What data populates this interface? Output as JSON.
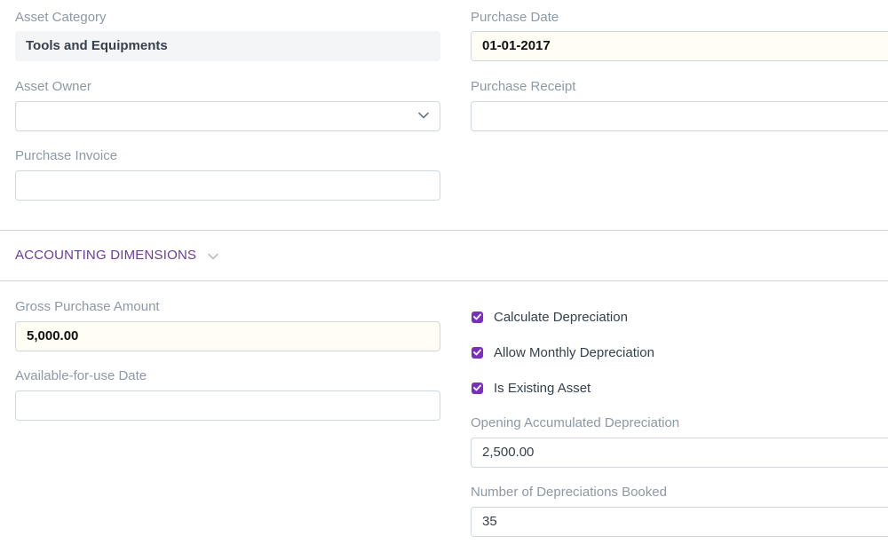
{
  "fields": {
    "asset_category": {
      "label": "Asset Category",
      "value": "Tools and Equipments"
    },
    "purchase_date": {
      "label": "Purchase Date",
      "value": "01-01-2017"
    },
    "asset_owner": {
      "label": "Asset Owner",
      "value": ""
    },
    "purchase_receipt": {
      "label": "Purchase Receipt",
      "value": ""
    },
    "purchase_invoice": {
      "label": "Purchase Invoice",
      "value": ""
    },
    "gross_purchase_amount": {
      "label": "Gross Purchase Amount",
      "value": "5,000.00"
    },
    "available_for_use_date": {
      "label": "Available-for-use Date",
      "value": ""
    },
    "opening_accumulated_depreciation": {
      "label": "Opening Accumulated Depreciation",
      "value": "2,500.00"
    },
    "number_of_depreciations_booked": {
      "label": "Number of Depreciations Booked",
      "value": "35"
    }
  },
  "section": {
    "title": "ACCOUNTING DIMENSIONS"
  },
  "checkboxes": {
    "calculate_depreciation": {
      "label": "Calculate Depreciation",
      "checked": true
    },
    "allow_monthly_depreciation": {
      "label": "Allow Monthly Depreciation",
      "checked": true
    },
    "is_existing_asset": {
      "label": "Is Existing Asset",
      "checked": true
    }
  },
  "colors": {
    "accent": "#7b2fbe",
    "section_title": "#6a3d9a",
    "label": "#8d99a6",
    "highlight_bg": "#fffdf4"
  }
}
